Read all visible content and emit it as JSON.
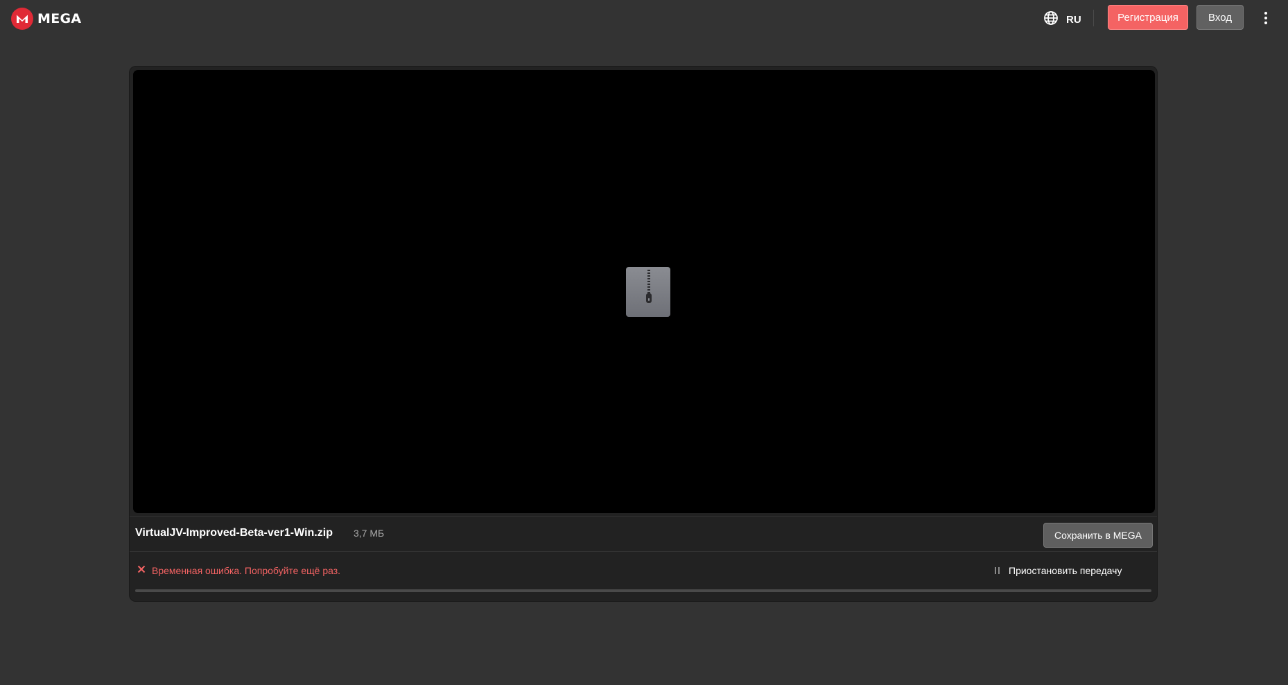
{
  "header": {
    "logo_text": "MEGA",
    "language": "RU",
    "register_label": "Регистрация",
    "login_label": "Вход",
    "menu_icon": "kebab-menu-icon"
  },
  "file": {
    "name": "VirtualJV-Improved-Beta-ver1-Win.zip",
    "size": "3,7 МБ",
    "icon": "zip-archive-icon"
  },
  "actions": {
    "save_label": "Сохранить в MEGA",
    "pause_label": "Приостановить передачу"
  },
  "status": {
    "error_text": "Временная ошибка. Попробуйте ещё раз.",
    "progress_fraction": 0
  },
  "colors": {
    "accent": "#f46363",
    "brand": "#e02a36",
    "background": "#333333",
    "card": "#222222",
    "preview": "#000000"
  }
}
